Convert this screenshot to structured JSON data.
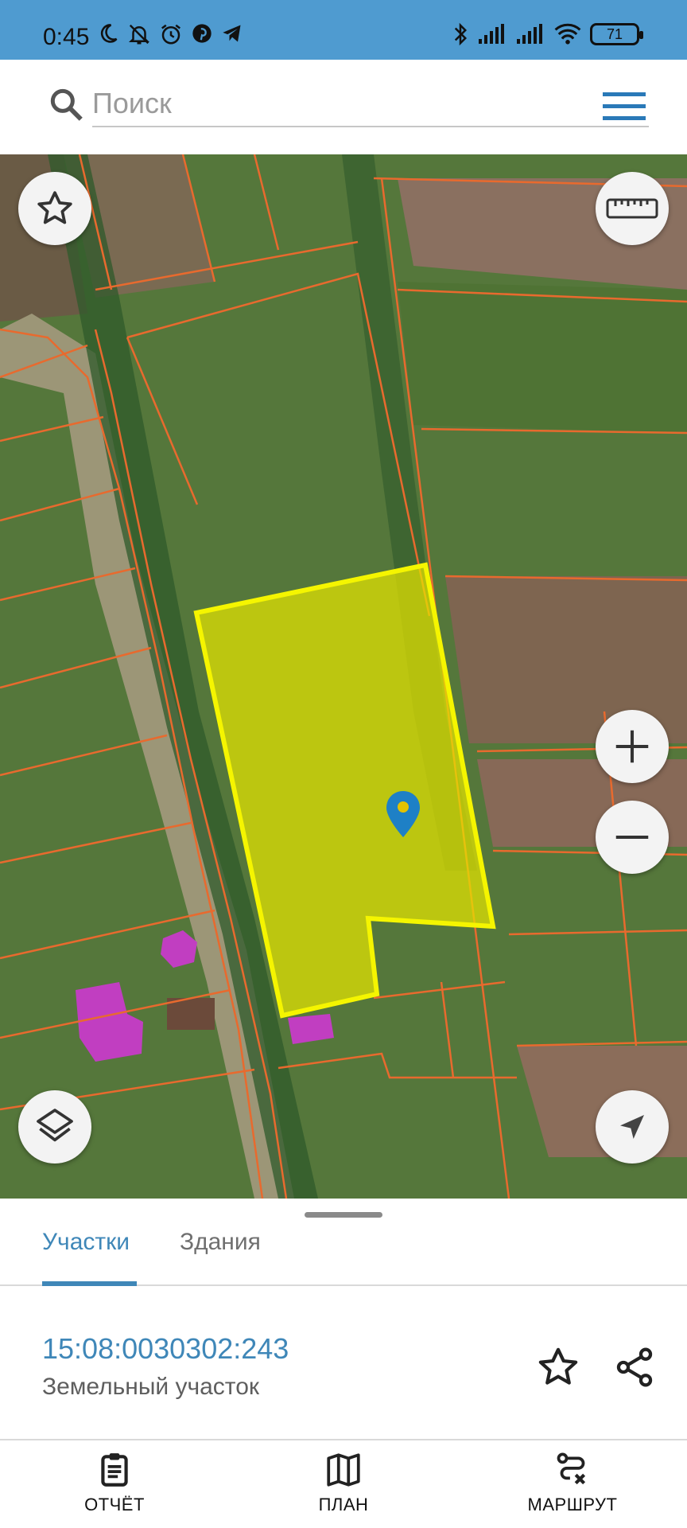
{
  "status_bar": {
    "time": "0:45",
    "battery": "71",
    "background": "#4f9bd0"
  },
  "search": {
    "placeholder": "Поиск",
    "icons": [
      "search-icon",
      "menu-icon"
    ]
  },
  "map": {
    "controls": [
      "favorites-star-icon",
      "ruler-icon",
      "zoom-in-icon",
      "zoom-out-icon",
      "layers-icon",
      "navigation-arrow-icon"
    ],
    "selected_parcel_color": "#f5f500",
    "boundary_color": "#e86a2e",
    "marker_color": "#1e80c6"
  },
  "sheet": {
    "tabs": [
      {
        "label": "Участки",
        "active": true
      },
      {
        "label": "Здания",
        "active": false
      }
    ],
    "parcel": {
      "cadastral_number": "15:08:0030302:243",
      "type": "Земельный участок"
    },
    "accent": "#3f87b8"
  },
  "bottom_nav": {
    "items": [
      {
        "label": "ОТЧЁТ",
        "icon": "report-clipboard-icon"
      },
      {
        "label": "ПЛАН",
        "icon": "map-plan-icon"
      },
      {
        "label": "МАРШРУТ",
        "icon": "route-icon"
      }
    ]
  }
}
